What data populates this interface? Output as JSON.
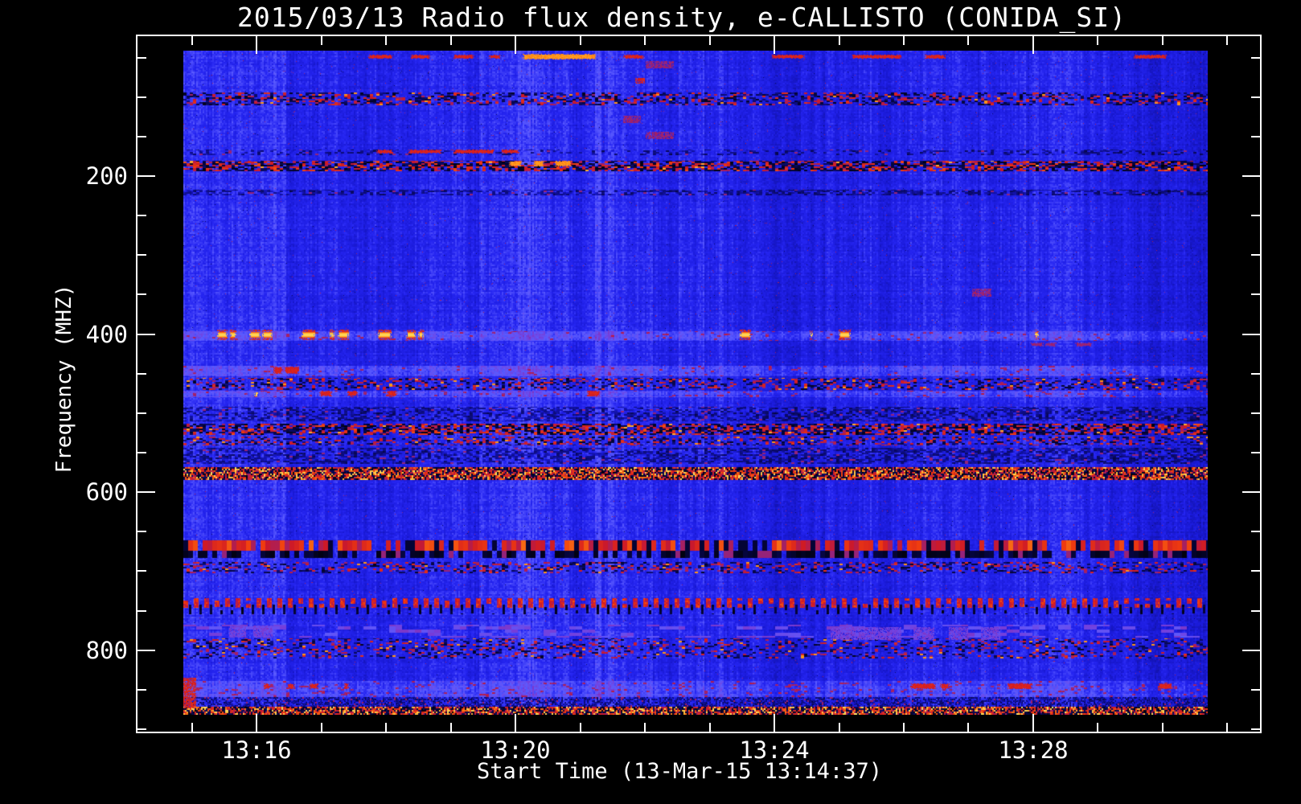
{
  "figure": {
    "background": "#000000",
    "foreground": "#ffffff"
  },
  "chart_data": {
    "type": "heatmap",
    "kind": "solar-radio-spectrogram",
    "title": "2015/03/13  Radio flux density, e-CALLISTO (CONIDA_SI)",
    "date": "2015/03/13",
    "instrument": "e-CALLISTO",
    "station": "CONIDA_SI",
    "xlabel": "Start Time (13-Mar-15 13:14:37)",
    "ylabel": "Frequency (MHZ)",
    "x_axis": {
      "tick_labels": [
        "13:16",
        "13:20",
        "13:24",
        "13:28"
      ],
      "tick_fracs": [
        0.106,
        0.3366,
        0.5673,
        0.7979
      ],
      "minor_start_frac": 0.0484,
      "minor_step_frac": 0.05766,
      "minor_count": 17,
      "major_indices": [
        1,
        5,
        9,
        13
      ]
    },
    "y_axis": {
      "f_min": 23,
      "f_max": 903,
      "major_ticks": [
        200,
        400,
        600,
        800
      ],
      "minor_step": 50,
      "minor_min": 50,
      "minor_max": 900,
      "direction": "increasing-downward"
    },
    "background_level": 0.455,
    "palette": [
      [
        0.0,
        0,
        0,
        0
      ],
      [
        0.16,
        8,
        8,
        85
      ],
      [
        0.3,
        16,
        16,
        150
      ],
      [
        0.4,
        26,
        26,
        215
      ],
      [
        0.47,
        38,
        38,
        242
      ],
      [
        0.55,
        92,
        92,
        255
      ],
      [
        0.62,
        120,
        60,
        215
      ],
      [
        0.7,
        150,
        35,
        120
      ],
      [
        0.78,
        205,
        25,
        40
      ],
      [
        0.86,
        240,
        60,
        15
      ],
      [
        0.93,
        255,
        150,
        25
      ],
      [
        1.0,
        255,
        230,
        100
      ]
    ],
    "rfi_bands": [
      {
        "f": [
          94,
          109
        ],
        "style": "speckle",
        "density": 0.55
      },
      {
        "f": [
          166,
          173
        ],
        "style": "faint",
        "density": 0.3
      },
      {
        "f": [
          181,
          193
        ],
        "style": "strong",
        "density": 0.8
      },
      {
        "f": [
          217,
          223
        ],
        "style": "faint",
        "density": 0.55
      },
      {
        "f": [
          396,
          408
        ],
        "style": "light",
        "density": 0.05
      },
      {
        "f": [
          440,
          452
        ],
        "style": "light",
        "density": 0.05
      },
      {
        "f": [
          455,
          470
        ],
        "style": "speckle",
        "density": 0.45
      },
      {
        "f": [
          472,
          479
        ],
        "style": "light",
        "density": 0.07
      },
      {
        "f": [
          492,
          509
        ],
        "style": "faint",
        "density": 0.5
      },
      {
        "f": [
          513,
          527
        ],
        "style": "strong",
        "density": 0.8
      },
      {
        "f": [
          530,
          540
        ],
        "style": "speckle",
        "density": 0.5
      },
      {
        "f": [
          544,
          563
        ],
        "style": "faint",
        "density": 0.55
      },
      {
        "f": [
          568,
          584
        ],
        "style": "intense",
        "density": 0.9
      },
      {
        "f": [
          661,
          682
        ],
        "style": "blocky",
        "density": 0.85
      },
      {
        "f": [
          688,
          702
        ],
        "style": "speckle",
        "density": 0.45
      },
      {
        "f": [
          734,
          753
        ],
        "style": "periodic",
        "density": 0.8
      },
      {
        "f": [
          768,
          783
        ],
        "style": "patches",
        "density": 0.3
      },
      {
        "f": [
          785,
          809
        ],
        "style": "speckle",
        "density": 0.35
      },
      {
        "f": [
          839,
          858
        ],
        "style": "light",
        "density": 0.08
      },
      {
        "f": [
          859,
          870
        ],
        "style": "faint-dark",
        "density": 0.55
      },
      {
        "f": [
          871,
          882
        ],
        "style": "intense",
        "density": 0.88
      }
    ],
    "dash_rows": [
      {
        "f": 400,
        "h": 12,
        "tone": "yellow",
        "spans": [
          [
            0.033,
            0.042
          ],
          [
            0.0455,
            0.051
          ],
          [
            0.064,
            0.0746
          ],
          [
            0.0769,
            0.0863
          ],
          [
            0.1154,
            0.128
          ],
          [
            0.1429,
            0.1468
          ],
          [
            0.1507,
            0.1609
          ],
          [
            0.19,
            0.2025
          ],
          [
            0.2174,
            0.2261
          ],
          [
            0.2292,
            0.2339
          ],
          [
            0.5432,
            0.5534
          ],
          [
            0.6114,
            0.6138
          ],
          [
            0.6397,
            0.6507
          ],
          [
            0.8312,
            0.8344
          ]
        ]
      },
      {
        "f": 413,
        "h": 5,
        "tone": "darkred",
        "spans": [
          [
            0.8273,
            0.8391
          ],
          [
            0.8414,
            0.8516
          ],
          [
            0.8705,
            0.8862
          ]
        ]
      },
      {
        "f": 445,
        "h": 8,
        "tone": "red",
        "spans": [
          [
            0.088,
            0.096
          ],
          [
            0.099,
            0.112
          ]
        ]
      },
      {
        "f": 475,
        "h": 6,
        "tone": "red",
        "spans": [
          [
            0.1327,
            0.1444
          ],
          [
            0.1601,
            0.1695
          ],
          [
            0.1986,
            0.208
          ],
          [
            0.394,
            0.406
          ]
        ]
      },
      {
        "f": 476,
        "h": 5,
        "tone": "yellow",
        "spans": [
          [
            0.0691,
            0.0722
          ]
        ]
      },
      {
        "f": 168,
        "h": 5,
        "tone": "red",
        "spans": [
          [
            0.188,
            0.204
          ],
          [
            0.22,
            0.251
          ],
          [
            0.264,
            0.303
          ],
          [
            0.311,
            0.327
          ]
        ]
      },
      {
        "f": 184,
        "h": 6,
        "tone": "orange",
        "spans": [
          [
            0.318,
            0.33
          ],
          [
            0.342,
            0.352
          ],
          [
            0.363,
            0.378
          ]
        ]
      },
      {
        "f": 845,
        "h": 7,
        "tone": "red",
        "spans": [
          [
            0.0785,
            0.084
          ],
          [
            0.102,
            0.108
          ],
          [
            0.123,
            0.131
          ],
          [
            0.157,
            0.161
          ],
          [
            0.71,
            0.734
          ],
          [
            0.739,
            0.747
          ],
          [
            0.8045,
            0.828
          ],
          [
            0.951,
            0.9655
          ]
        ]
      },
      {
        "f": 48,
        "h": 7,
        "tone": "orange",
        "spans": [
          [
            0.331,
            0.402
          ]
        ]
      },
      {
        "f": 48,
        "h": 5,
        "tone": "red",
        "spans": [
          [
            0.1805,
            0.2041
          ],
          [
            0.2221,
            0.2402
          ],
          [
            0.2637,
            0.2826
          ],
          [
            0.2983,
            0.3085
          ],
          [
            0.4293,
            0.449
          ],
          [
            0.5746,
            0.606
          ],
          [
            0.6531,
            0.7002
          ],
          [
            0.7237,
            0.7433
          ],
          [
            0.928,
            0.959
          ]
        ]
      }
    ],
    "patches": [
      {
        "f": [
          55,
          63
        ],
        "x": [
          0.4513,
          0.478
        ],
        "tone": "darkred"
      },
      {
        "f": [
          76,
          82
        ],
        "x": [
          0.441,
          0.45
        ],
        "tone": "red"
      },
      {
        "f": [
          124,
          132
        ],
        "x": [
          0.429,
          0.446
        ],
        "tone": "darkred"
      },
      {
        "f": [
          144,
          152
        ],
        "x": [
          0.4513,
          0.478
        ],
        "tone": "darkred"
      },
      {
        "f": [
          342,
          352
        ],
        "x": [
          0.77,
          0.788
        ],
        "tone": "darkred"
      },
      {
        "f": [
          769,
          783
        ],
        "x": [
          0.0447,
          0.0604
        ],
        "tone": "purple"
      },
      {
        "f": [
          769,
          783
        ],
        "x": [
          0.0683,
          0.0863
        ],
        "tone": "purple"
      },
      {
        "f": [
          771,
          786
        ],
        "x": [
          0.632,
          0.7
        ],
        "tone": "purple"
      },
      {
        "f": [
          771,
          786
        ],
        "x": [
          0.713,
          0.732
        ],
        "tone": "purple"
      },
      {
        "f": [
          771,
          786
        ],
        "x": [
          0.747,
          0.765
        ],
        "tone": "purple"
      },
      {
        "f": [
          771,
          786
        ],
        "x": [
          0.779,
          0.797
        ],
        "tone": "purple"
      },
      {
        "f": [
          835,
          872
        ],
        "x": [
          0.0,
          0.012
        ],
        "tone": "red"
      }
    ]
  }
}
